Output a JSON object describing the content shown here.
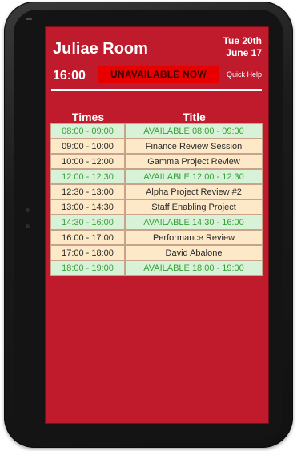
{
  "room": {
    "name": "Juliae Room"
  },
  "date": {
    "line1": "Tue 20th",
    "line2": "June 17"
  },
  "clock": {
    "time": "16:00"
  },
  "status": {
    "label": "UNAVAILABLE NOW",
    "color": "#e80000"
  },
  "help": {
    "label": "Quick Help"
  },
  "schedule": {
    "headers": {
      "times": "Times",
      "title": "Title"
    },
    "rows": [
      {
        "time": "08:00 - 09:00",
        "title": "AVAILABLE 08:00 - 09:00",
        "type": "free"
      },
      {
        "time": "09:00 - 10:00",
        "title": "Finance Review Session",
        "type": "busy"
      },
      {
        "time": "10:00 - 12:00",
        "title": "Gamma Project Review",
        "type": "busy"
      },
      {
        "time": "12:00 - 12:30",
        "title": "AVAILABLE 12:00 - 12:30",
        "type": "free"
      },
      {
        "time": "12:30 - 13:00",
        "title": "Alpha Project Review #2",
        "type": "busy"
      },
      {
        "time": "13:00 - 14:30",
        "title": "Staff Enabling Project",
        "type": "busy"
      },
      {
        "time": "14:30 - 16:00",
        "title": "AVAILABLE 14:30 - 16:00",
        "type": "free"
      },
      {
        "time": "16:00 - 17:00",
        "title": "Performance Review",
        "type": "busy"
      },
      {
        "time": "17:00 - 18:00",
        "title": "David Abalone",
        "type": "busy"
      },
      {
        "time": "18:00 - 19:00",
        "title": "AVAILABLE 18:00 - 19:00",
        "type": "free"
      }
    ]
  },
  "colors": {
    "screen_bg": "#bf1b2c",
    "available_bg": "#d8f2d7",
    "available_text": "#3aa03a",
    "booked_bg": "#fde8c8"
  }
}
